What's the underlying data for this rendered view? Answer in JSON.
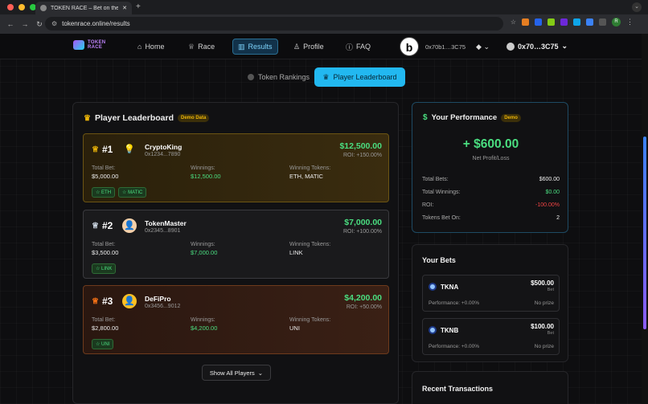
{
  "browser": {
    "tab_title": "TOKEN RACE – Bet on the ha",
    "url": "tokenrace.online/results"
  },
  "header": {
    "logo_text_1": "TOKEN",
    "logo_text_2": "RACE",
    "nav": [
      {
        "label": "Home",
        "icon": "home-icon"
      },
      {
        "label": "Race",
        "icon": "trophy-icon"
      },
      {
        "label": "Results",
        "icon": "chart-icon"
      },
      {
        "label": "Profile",
        "icon": "user-icon"
      },
      {
        "label": "FAQ",
        "icon": "help-icon"
      }
    ],
    "wallet_short": "0x70b1…3C75",
    "network_icon": "ethereum-icon",
    "account": "0x70…3C75"
  },
  "toggles": {
    "token_rankings": "Token Rankings",
    "player_leaderboard": "Player Leaderboard"
  },
  "leaderboard": {
    "title": "Player Leaderboard",
    "badge": "Demo Data",
    "labels": {
      "total_bet": "Total Bet:",
      "winnings": "Winnings:",
      "winning_tokens": "Winning Tokens:"
    },
    "players": [
      {
        "rank": "#1",
        "name": "CryptoKing",
        "address": "0x1234...7890",
        "amount": "$12,500.00",
        "roi": "ROI: +150.00%",
        "total_bet": "$5,000.00",
        "winnings": "$12,500.00",
        "winning_tokens": "ETH, MATIC",
        "tags": [
          "☆ ETH",
          "☆ MATIC"
        ]
      },
      {
        "rank": "#2",
        "name": "TokenMaster",
        "address": "0x2345...8901",
        "amount": "$7,000.00",
        "roi": "ROI: +100.00%",
        "total_bet": "$3,500.00",
        "winnings": "$7,000.00",
        "winning_tokens": "LINK",
        "tags": [
          "☆ LINK"
        ]
      },
      {
        "rank": "#3",
        "name": "DeFiPro",
        "address": "0x3456...9012",
        "amount": "$4,200.00",
        "roi": "ROI: +50.00%",
        "total_bet": "$2,800.00",
        "winnings": "$4,200.00",
        "winning_tokens": "UNI",
        "tags": [
          "☆ UNI"
        ]
      }
    ],
    "show_all": "Show All Players"
  },
  "performance": {
    "title": "Your Performance",
    "badge": "Demo",
    "net": "+ $600.00",
    "net_label": "Net Profit/Loss",
    "rows": [
      {
        "label": "Total Bets:",
        "value": "$600.00"
      },
      {
        "label": "Total Winnings:",
        "value": "$0.00"
      },
      {
        "label": "ROI:",
        "value": "-100.00%"
      },
      {
        "label": "Tokens Bet On:",
        "value": "2"
      }
    ]
  },
  "bets": {
    "title": "Your Bets",
    "bet_label": "Bet",
    "items": [
      {
        "token": "TKNA",
        "amount": "$500.00",
        "performance": "Performance: +0.00%",
        "prize": "No prize"
      },
      {
        "token": "TKNB",
        "amount": "$100.00",
        "performance": "Performance: +0.00%",
        "prize": "No prize"
      }
    ]
  },
  "transactions": {
    "title": "Recent Transactions"
  }
}
